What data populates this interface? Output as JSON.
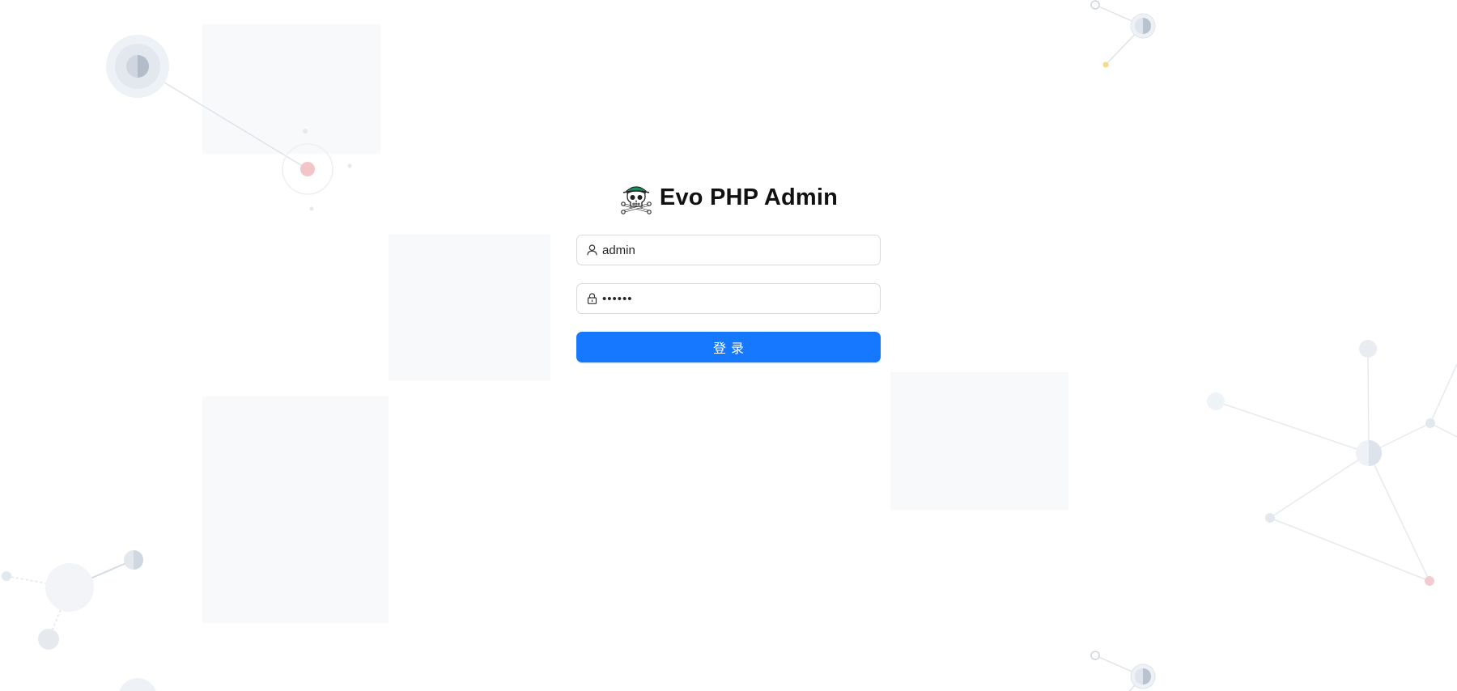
{
  "app": {
    "title": "Evo PHP Admin",
    "logo_icon": "skull-pirate-icon"
  },
  "login_form": {
    "username": {
      "icon": "user-icon",
      "value": "admin"
    },
    "password": {
      "icon": "lock-icon",
      "value": "••••••"
    },
    "submit_label": "登录"
  },
  "colors": {
    "primary": "#1677ff",
    "input_border": "#d9d9d9",
    "text": "#111111",
    "background": "#ffffff"
  }
}
